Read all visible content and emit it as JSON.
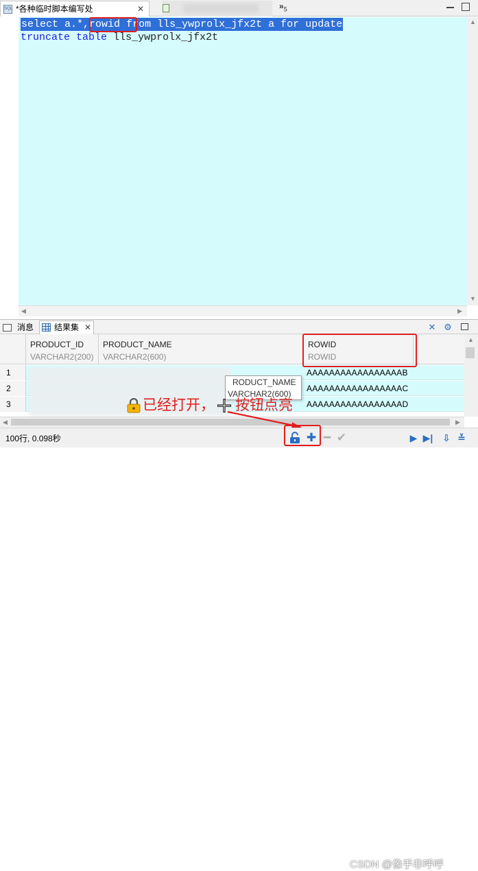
{
  "editor_tabs": [
    {
      "label": "*各种临时脚本编写处",
      "close": "✕"
    },
    {
      "overflow": "»",
      "overflow_count": "5"
    }
  ],
  "sql": {
    "line1": {
      "kw1": "select",
      "t1": " a.*,",
      "rowid": "rowid",
      "kw2": "from",
      "table": "lls_ywprolx_jfx2t",
      "alias": "a",
      "kw3": "for",
      "kw4": "update"
    },
    "line2": {
      "kw1": "truncate",
      "kw2": "table",
      "table": "lls_ywprolx_jfx2t"
    }
  },
  "view_tabs": {
    "messages": "消息",
    "results": "结果集",
    "results_close": "✕"
  },
  "grid": {
    "columns": [
      {
        "name": "PRODUCT_ID",
        "type": "VARCHAR2(200)"
      },
      {
        "name": "PRODUCT_NAME",
        "type": "VARCHAR2(600)"
      },
      {
        "name": "ROWID",
        "type": "ROWID"
      }
    ],
    "rows": [
      {
        "num": "1",
        "rowid": "AAAAAAAAAAAAAAAAAB"
      },
      {
        "num": "2",
        "rowid": "AAAAAAAAAAAAAAAAAC"
      },
      {
        "num": "3",
        "rowid": "AAAAAAAAAAAAAAAAAD"
      }
    ]
  },
  "tooltip": {
    "name": "RODUCT_NAME",
    "type": "VARCHAR2(600)"
  },
  "annotation": {
    "part1": "已经打开，",
    "part2": "按钮点亮"
  },
  "status": {
    "text": "100行, 0.098秒"
  },
  "watermark": "CSDN @像乎非呼呼",
  "colors": {
    "accent_red": "#e21d1d",
    "editor_bg": "#d6fbfd",
    "selection": "#2f6fd8",
    "keyword": "#1d1de0"
  }
}
